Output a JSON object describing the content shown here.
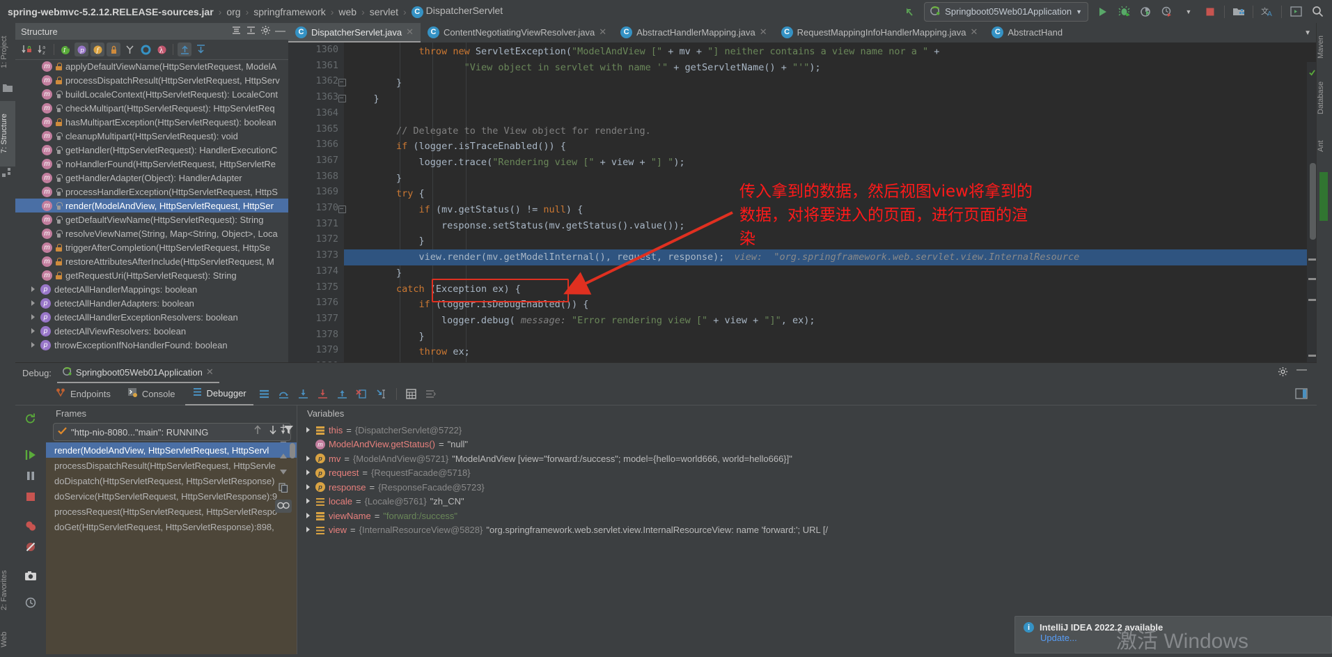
{
  "topbar": {
    "breadcrumbs": [
      {
        "label": "spring-webmvc-5.2.12.RELEASE-sources.jar",
        "bold": true
      },
      {
        "label": "org",
        "bold": false
      },
      {
        "label": "springframework",
        "bold": false
      },
      {
        "label": "web",
        "bold": false
      },
      {
        "label": "servlet",
        "bold": false
      },
      {
        "label": "DispatcherServlet",
        "bold": false,
        "icon": "class-icon"
      }
    ],
    "separator": "›",
    "run_config": "Springboot05Web01Application",
    "icons": [
      "back-arrow-icon",
      "run-icon",
      "debug-icon",
      "run-with-coverage-icon",
      "profiler-icon",
      "stop-icon",
      "build-project-icon",
      "translate-icon",
      "terminal-icon",
      "search-everywhere-icon"
    ]
  },
  "left_strip": {
    "tabs": [
      "1: Project",
      "7: Structure"
    ],
    "bottom_tabs": [
      "2: Favorites",
      "Web"
    ]
  },
  "right_strip": {
    "tabs": [
      "Maven",
      "Database",
      "Ant"
    ]
  },
  "structure": {
    "title": "Structure",
    "toolbar_icons": [
      "sort-by-visibility-icon",
      "sort-alphabetically-icon",
      "show-inherited-icon",
      "show-properties-icon",
      "show-fields-icon",
      "show-non-public-icon",
      "group-by-class-icon",
      "show-anonymous-icon",
      "show-lambdas-icon",
      "expand-all-icon",
      "collapse-all-icon"
    ],
    "header_icons": [
      "collapse-all-icon",
      "settings-gear-icon",
      "hide-icon"
    ],
    "items": [
      {
        "label": "applyDefaultViewName(HttpServletRequest, ModelA",
        "kind": "method",
        "vis": "protected",
        "selected": false,
        "level": 1
      },
      {
        "label": "processDispatchResult(HttpServletRequest, HttpServ",
        "kind": "method",
        "vis": "protected",
        "selected": false,
        "level": 1
      },
      {
        "label": "buildLocaleContext(HttpServletRequest): LocaleCont",
        "kind": "method",
        "vis": "public",
        "selected": false,
        "level": 1
      },
      {
        "label": "checkMultipart(HttpServletRequest): HttpServletReq",
        "kind": "method",
        "vis": "public",
        "selected": false,
        "level": 1
      },
      {
        "label": "hasMultipartException(HttpServletRequest): boolean",
        "kind": "method",
        "vis": "protected",
        "selected": false,
        "level": 1
      },
      {
        "label": "cleanupMultipart(HttpServletRequest): void",
        "kind": "method",
        "vis": "public",
        "selected": false,
        "level": 1
      },
      {
        "label": "getHandler(HttpServletRequest): HandlerExecutionC",
        "kind": "method",
        "vis": "public",
        "selected": false,
        "level": 1
      },
      {
        "label": "noHandlerFound(HttpServletRequest, HttpServletRe",
        "kind": "method",
        "vis": "public",
        "selected": false,
        "level": 1
      },
      {
        "label": "getHandlerAdapter(Object): HandlerAdapter",
        "kind": "method",
        "vis": "public",
        "selected": false,
        "level": 1
      },
      {
        "label": "processHandlerException(HttpServletRequest, HttpS",
        "kind": "method",
        "vis": "public",
        "selected": false,
        "level": 1
      },
      {
        "label": "render(ModelAndView, HttpServletRequest, HttpSer",
        "kind": "method",
        "vis": "public",
        "selected": true,
        "level": 1
      },
      {
        "label": "getDefaultViewName(HttpServletRequest): String",
        "kind": "method",
        "vis": "public",
        "selected": false,
        "level": 1
      },
      {
        "label": "resolveViewName(String, Map<String, Object>, Loca",
        "kind": "method",
        "vis": "public",
        "selected": false,
        "level": 1
      },
      {
        "label": "triggerAfterCompletion(HttpServletRequest, HttpSe",
        "kind": "method",
        "vis": "protected",
        "selected": false,
        "level": 1
      },
      {
        "label": "restoreAttributesAfterInclude(HttpServletRequest, M",
        "kind": "method",
        "vis": "protected",
        "selected": false,
        "level": 1
      },
      {
        "label": "getRequestUri(HttpServletRequest): String",
        "kind": "method",
        "vis": "protected",
        "selected": false,
        "level": 1
      },
      {
        "label": "detectAllHandlerMappings: boolean",
        "kind": "property",
        "vis": "none",
        "selected": false,
        "level": 0
      },
      {
        "label": "detectAllHandlerAdapters: boolean",
        "kind": "property",
        "vis": "none",
        "selected": false,
        "level": 0
      },
      {
        "label": "detectAllHandlerExceptionResolvers: boolean",
        "kind": "property",
        "vis": "none",
        "selected": false,
        "level": 0
      },
      {
        "label": "detectAllViewResolvers: boolean",
        "kind": "property",
        "vis": "none",
        "selected": false,
        "level": 0
      },
      {
        "label": "throwExceptionIfNoHandlerFound: boolean",
        "kind": "property",
        "vis": "none",
        "selected": false,
        "level": 0
      }
    ]
  },
  "editor": {
    "tabs": [
      {
        "label": "DispatcherServlet.java",
        "active": true,
        "closable": true
      },
      {
        "label": "ContentNegotiatingViewResolver.java",
        "active": false,
        "closable": true
      },
      {
        "label": "AbstractHandlerMapping.java",
        "active": false,
        "closable": true
      },
      {
        "label": "RequestMappingInfoHandlerMapping.java",
        "active": false,
        "closable": true
      },
      {
        "label": "AbstractHand",
        "active": false,
        "closable": false
      }
    ],
    "first_line_number": 1360,
    "lines": [
      {
        "n": 1360,
        "segments": [
          {
            "t": "            ",
            "c": "t"
          },
          {
            "t": "throw",
            "c": "k"
          },
          {
            "t": " ",
            "c": "t"
          },
          {
            "t": "new",
            "c": "k"
          },
          {
            "t": " ServletException(",
            "c": "t"
          },
          {
            "t": "\"ModelAndView [\"",
            "c": "s"
          },
          {
            "t": " + mv + ",
            "c": "t"
          },
          {
            "t": "\"] neither contains a view name nor a \"",
            "c": "s"
          },
          {
            "t": " +",
            "c": "t"
          }
        ]
      },
      {
        "n": 1361,
        "segments": [
          {
            "t": "                    ",
            "c": "t"
          },
          {
            "t": "\"View object in servlet with name '\"",
            "c": "s"
          },
          {
            "t": " + getServletName() + ",
            "c": "t"
          },
          {
            "t": "\"'\"",
            "c": "s"
          },
          {
            "t": ");",
            "c": "t"
          }
        ]
      },
      {
        "n": 1362,
        "segments": [
          {
            "t": "        }",
            "c": "t"
          }
        ],
        "fold": true
      },
      {
        "n": 1363,
        "segments": [
          {
            "t": "    }",
            "c": "t"
          }
        ],
        "fold": true
      },
      {
        "n": 1364,
        "segments": []
      },
      {
        "n": 1365,
        "segments": [
          {
            "t": "        ",
            "c": "t"
          },
          {
            "t": "// Delegate to the View object for rendering.",
            "c": "c"
          }
        ]
      },
      {
        "n": 1366,
        "segments": [
          {
            "t": "        ",
            "c": "t"
          },
          {
            "t": "if",
            "c": "k"
          },
          {
            "t": " (logger.isTraceEnabled()) {",
            "c": "t"
          }
        ]
      },
      {
        "n": 1367,
        "segments": [
          {
            "t": "            logger.trace(",
            "c": "t"
          },
          {
            "t": "\"Rendering view [\"",
            "c": "s"
          },
          {
            "t": " + view + ",
            "c": "t"
          },
          {
            "t": "\"] \"",
            "c": "s"
          },
          {
            "t": ");",
            "c": "t"
          }
        ]
      },
      {
        "n": 1368,
        "segments": [
          {
            "t": "        }",
            "c": "t"
          }
        ]
      },
      {
        "n": 1369,
        "segments": [
          {
            "t": "        ",
            "c": "t"
          },
          {
            "t": "try",
            "c": "k"
          },
          {
            "t": " {",
            "c": "t"
          }
        ]
      },
      {
        "n": 1370,
        "segments": [
          {
            "t": "            ",
            "c": "t"
          },
          {
            "t": "if",
            "c": "k"
          },
          {
            "t": " (mv.getStatus() != ",
            "c": "t"
          },
          {
            "t": "null",
            "c": "k"
          },
          {
            "t": ") {",
            "c": "t"
          }
        ],
        "fold": true
      },
      {
        "n": 1371,
        "segments": [
          {
            "t": "                response.setStatus(mv.getStatus().value());",
            "c": "t"
          }
        ]
      },
      {
        "n": 1372,
        "segments": [
          {
            "t": "            }",
            "c": "t"
          }
        ]
      },
      {
        "n": 1373,
        "segments": [
          {
            "t": "            view.render(mv.getModelInternal(), request, response);",
            "c": "t"
          }
        ],
        "highlighted": true,
        "inline_hint": "view:  \"org.springframework.web.servlet.view.InternalResource"
      },
      {
        "n": 1374,
        "segments": [
          {
            "t": "        }",
            "c": "t"
          }
        ]
      },
      {
        "n": 1375,
        "segments": [
          {
            "t": "        ",
            "c": "t"
          },
          {
            "t": "catch",
            "c": "k"
          },
          {
            "t": " (Exception ex) {",
            "c": "t"
          }
        ]
      },
      {
        "n": 1376,
        "segments": [
          {
            "t": "            ",
            "c": "t"
          },
          {
            "t": "if",
            "c": "k"
          },
          {
            "t": " (logger.isDebugEnabled()) {",
            "c": "t"
          }
        ]
      },
      {
        "n": 1377,
        "segments": [
          {
            "t": "                logger.debug( ",
            "c": "t"
          },
          {
            "t": "message:",
            "c": "hint"
          },
          {
            "t": " ",
            "c": "t"
          },
          {
            "t": "\"Error rendering view [\"",
            "c": "s"
          },
          {
            "t": " + view + ",
            "c": "t"
          },
          {
            "t": "\"]\"",
            "c": "s"
          },
          {
            "t": ", ex);",
            "c": "t"
          }
        ]
      },
      {
        "n": 1378,
        "segments": [
          {
            "t": "            }",
            "c": "t"
          }
        ]
      },
      {
        "n": 1379,
        "segments": [
          {
            "t": "            ",
            "c": "t"
          },
          {
            "t": "throw",
            "c": "k"
          },
          {
            "t": " ex;",
            "c": "t"
          }
        ]
      },
      {
        "n": 1380,
        "segments": [
          {
            "t": "        }",
            "c": "t"
          }
        ]
      }
    ],
    "annotation": "传入拿到的数据，然后视图view将拿到的\n数据，对将要进入的页面，进行页面的渲\n染",
    "annotation_color": "#ff1a1a"
  },
  "debug": {
    "label": "Debug:",
    "session_tab": "Springboot05Web01Application",
    "tabs": [
      {
        "label": "Debugger",
        "selected": true,
        "icon": "debugger-icon"
      },
      {
        "label": "Console",
        "selected": false,
        "icon": "console-icon"
      },
      {
        "label": "Endpoints",
        "selected": false,
        "icon": "endpoints-icon"
      }
    ],
    "step_icons": [
      "show-execution-point-icon",
      "step-over-icon",
      "step-into-icon",
      "force-step-into-icon",
      "step-out-icon",
      "drop-frame-icon",
      "run-to-cursor-icon",
      "evaluate-expression-icon",
      "layout-icon"
    ],
    "side_icons": [
      "resume-program-icon",
      "pause-program-icon",
      "stop-icon",
      "view-breakpoints-icon",
      "mute-breakpoints-icon",
      "screenshot-icon",
      "restore-icon"
    ],
    "header_icons": [
      "settings-gear-icon",
      "hide-icon"
    ],
    "frames": {
      "title": "Frames",
      "thread": "\"http-nio-8080...\"main\": RUNNING",
      "toolbar_icons": [
        "move-up-icon",
        "move-down-icon",
        "filter-icon"
      ],
      "items": [
        {
          "label": "render(ModelAndView, HttpServletRequest, HttpServl",
          "selected": true
        },
        {
          "label": "processDispatchResult(HttpServletRequest, HttpServle",
          "selected": false
        },
        {
          "label": "doDispatch(HttpServletRequest, HttpServletResponse)",
          "selected": false
        },
        {
          "label": "doService(HttpServletRequest, HttpServletResponse):9",
          "selected": false
        },
        {
          "label": "processRequest(HttpServletRequest, HttpServletRespo",
          "selected": false
        },
        {
          "label": "doGet(HttpServletRequest, HttpServletResponse):898,",
          "selected": false
        }
      ]
    },
    "variables": {
      "title": "Variables",
      "toolbar_icons": [
        "add-icon",
        "remove-icon",
        "move-up-icon",
        "move-down-icon",
        "copy-icon",
        "watches-icon"
      ],
      "rows": [
        {
          "tri": true,
          "icon": "field-icon",
          "name": "this",
          "eq": " = ",
          "ref": "{DispatcherServlet@5722}",
          "value": "",
          "value_kind": "none"
        },
        {
          "tri": false,
          "icon": "method-icon",
          "name": "ModelAndView.getStatus()",
          "eq": " = ",
          "ref": "",
          "value": "\"null\"",
          "value_kind": "plain"
        },
        {
          "tri": true,
          "icon": "param-icon",
          "name": "mv",
          "eq": " = ",
          "ref": "{ModelAndView@5721}",
          "value": "\"ModelAndView [view=\"forward:/success\"; model={hello=world666, world=hello666}]\"",
          "value_kind": "plain"
        },
        {
          "tri": true,
          "icon": "param-icon",
          "name": "request",
          "eq": " = ",
          "ref": "{RequestFacade@5718}",
          "value": "",
          "value_kind": "none"
        },
        {
          "tri": true,
          "icon": "param-icon",
          "name": "response",
          "eq": " = ",
          "ref": "{ResponseFacade@5723}",
          "value": "",
          "value_kind": "none"
        },
        {
          "tri": true,
          "icon": "field-icon",
          "name": "locale",
          "eq": " = ",
          "ref": "{Locale@5761}",
          "value": "\"zh_CN\"",
          "value_kind": "plain"
        },
        {
          "tri": true,
          "icon": "field-icon",
          "name": "viewName",
          "eq": " = ",
          "ref": "",
          "value": "\"forward:/success\"",
          "value_kind": "string"
        },
        {
          "tri": true,
          "icon": "field-icon",
          "name": "view",
          "eq": " = ",
          "ref": "{InternalResourceView@5828}",
          "value": "\"org.springframework.web.servlet.view.InternalResourceView: name 'forward:'; URL [/",
          "value_kind": "plain"
        }
      ]
    }
  },
  "notification": {
    "title": "IntelliJ IDEA 2022.2 available",
    "action": "Update...",
    "icon": "info-icon"
  },
  "watermark": "激活 Windows"
}
